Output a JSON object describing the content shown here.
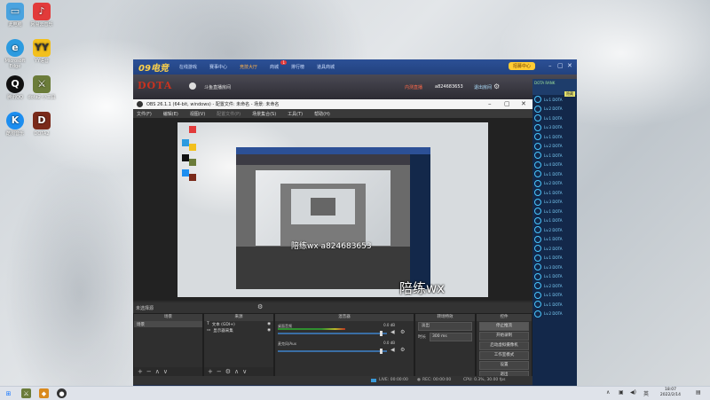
{
  "desktop": {
    "icons": [
      {
        "label": "此电脑",
        "icon": "computer-icon",
        "color": "#4aa3df"
      },
      {
        "label": "网易云音乐",
        "icon": "netease-music-icon",
        "color": "#e23b3b"
      },
      {
        "label": "Microsoft Edge",
        "icon": "edge-icon",
        "color": "#2c9be0"
      },
      {
        "label": "YY语音",
        "icon": "yy-icon",
        "color": "#f3c01d"
      },
      {
        "label": "腾讯QQ",
        "icon": "qq-icon",
        "color": "#111111"
      },
      {
        "label": "dota2 小工具",
        "icon": "dota-tool-icon",
        "color": "#6b7c3a"
      },
      {
        "label": "酷狗音乐",
        "icon": "kugou-icon",
        "color": "#1d8ef0"
      },
      {
        "label": "DOTA2",
        "icon": "dota2-icon",
        "color": "#7a2a1a"
      }
    ]
  },
  "client": {
    "logo": "09电竞",
    "tabs": [
      "在线游戏",
      "赛事中心",
      "竞技大厅",
      "商城",
      "排行榜",
      "道具商城"
    ],
    "active_tab_index": 2,
    "badge_tab_index": 3,
    "badge": "1",
    "recruit": "招募中心",
    "game_logo": "DOTA",
    "room_name": "斗鱼直播房间",
    "live": "内测直播",
    "user_id": "a824683653",
    "exit_room": "退出房间",
    "hide_button": "隐藏",
    "player_header": "DOTA RANK",
    "players": [
      "Lv.1 DOTA",
      "Lv.2 DOTA",
      "Lv.1 DOTA",
      "Lv.3 DOTA",
      "Lv.1 DOTA",
      "Lv.2 DOTA",
      "Lv.1 DOTA",
      "Lv.4 DOTA",
      "Lv.1 DOTA",
      "Lv.2 DOTA",
      "Lv.1 DOTA",
      "Lv.3 DOTA",
      "Lv.1 DOTA",
      "Lv.1 DOTA",
      "Lv.2 DOTA",
      "Lv.1 DOTA",
      "Lv.2 DOTA",
      "Lv.1 DOTA",
      "Lv.3 DOTA",
      "Lv.1 DOTA",
      "Lv.2 DOTA",
      "Lv.1 DOTA",
      "Lv.1 DOTA",
      "Lv.2 DOTA"
    ]
  },
  "obs": {
    "title": "OBS 26.1.1 (64-bit, windows) - 配置文件: 未命名 - 场景: 未命名",
    "menu": [
      "文件(F)",
      "编辑(E)",
      "视图(V)",
      "配置文件(P)",
      "场景集合(S)",
      "工具(T)",
      "帮助(H)"
    ],
    "overlay_text": "陪练wx a824683653",
    "scene_label": "未选择源",
    "docks": {
      "scenes": {
        "title": "场景",
        "items": [
          "场景"
        ]
      },
      "sources": {
        "title": "来源",
        "items": [
          "文本 (GDI+)",
          "显示器采集"
        ]
      },
      "mixer": {
        "title": "混音器",
        "tracks": [
          {
            "name": "桌面音频",
            "db": "0.0 dB",
            "level": 0.62,
            "volume": 0.95
          },
          {
            "name": "麦克风/Aux",
            "db": "0.0 dB",
            "level": 0.0,
            "volume": 0.95
          }
        ]
      },
      "transitions": {
        "title": "转场特效",
        "type": "淡出",
        "duration_label": "时长",
        "duration": "300 ms"
      },
      "controls": {
        "title": "控件",
        "buttons": [
          "停止推流",
          "开始录制",
          "启动虚拟摄像机",
          "工作室模式",
          "设置",
          "退出"
        ]
      }
    },
    "status": {
      "live": "LIVE: 00:00:00",
      "rec": "REC: 00:00:00",
      "cpu": "CPU: 0.3%, 30.00 fps"
    }
  },
  "taskbar": {
    "time": "18:07",
    "date": "2022/2/14"
  }
}
